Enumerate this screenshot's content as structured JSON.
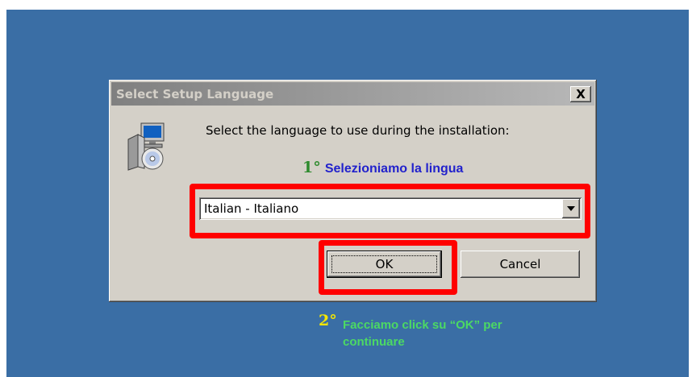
{
  "dialog": {
    "title": "Select Setup Language",
    "close_label": "X",
    "prompt": "Select the language to use during the installation:",
    "language_select": {
      "selected": "Italian - Italiano"
    },
    "ok_label": "OK",
    "cancel_label": "Cancel"
  },
  "annotations": {
    "step1_number": "1°",
    "step1_text": "Selezioniamo la lingua",
    "step2_number": "2°",
    "step2_text": "Facciamo click su “OK” per continuare"
  },
  "icons": {
    "setup": "setup-computer-cd-icon",
    "close": "close-icon",
    "dropdown": "chevron-down-icon"
  },
  "colors": {
    "desktop": "#3a6ea5",
    "dialog": "#d4d0c8",
    "highlight": "#ff0000",
    "step1_number": "#2e8b2e",
    "step1_text": "#2222cc",
    "step2_number": "#f5e600",
    "step2_text": "#4cd964"
  }
}
